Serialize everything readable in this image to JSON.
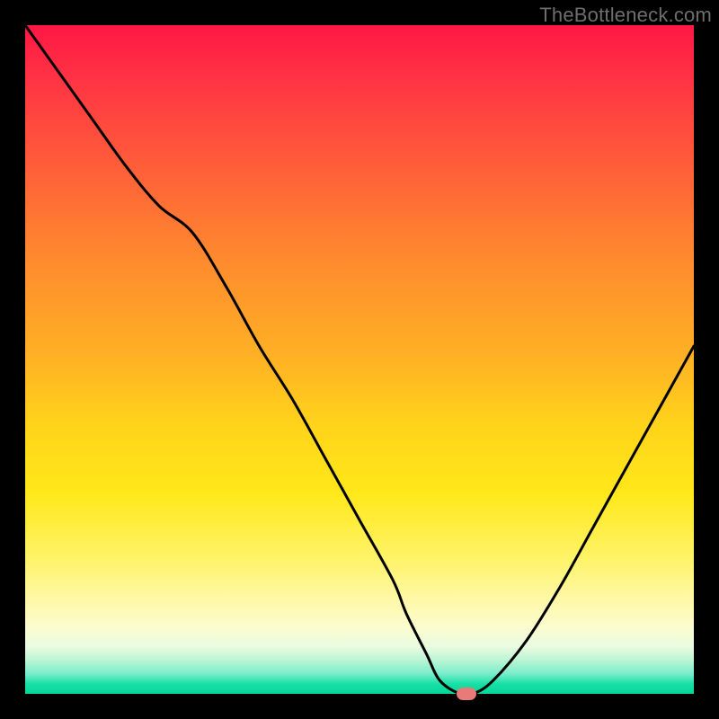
{
  "watermark": "TheBottleneck.com",
  "colors": {
    "frame": "#000000",
    "gradient_top": "#ff1744",
    "gradient_bottom": "#05d69a",
    "curve": "#000000",
    "marker": "#e87a77"
  },
  "chart_data": {
    "type": "line",
    "title": "",
    "xlabel": "",
    "ylabel": "",
    "xlim": [
      0,
      100
    ],
    "ylim": [
      0,
      100
    ],
    "x": [
      0,
      5,
      10,
      15,
      20,
      25,
      30,
      35,
      40,
      45,
      50,
      55,
      57,
      60,
      62,
      65,
      67,
      70,
      75,
      80,
      85,
      90,
      95,
      100
    ],
    "values": [
      100,
      93,
      86,
      79,
      73,
      69,
      61,
      52,
      44,
      35,
      26,
      17,
      12,
      6,
      2,
      0,
      0,
      2,
      8,
      16,
      25,
      34,
      43,
      52
    ],
    "marker": {
      "x": 66,
      "y": 0
    },
    "note": "Values are approximate percentages read from the plot; 0 = bottom (green), 100 = top (red)."
  }
}
